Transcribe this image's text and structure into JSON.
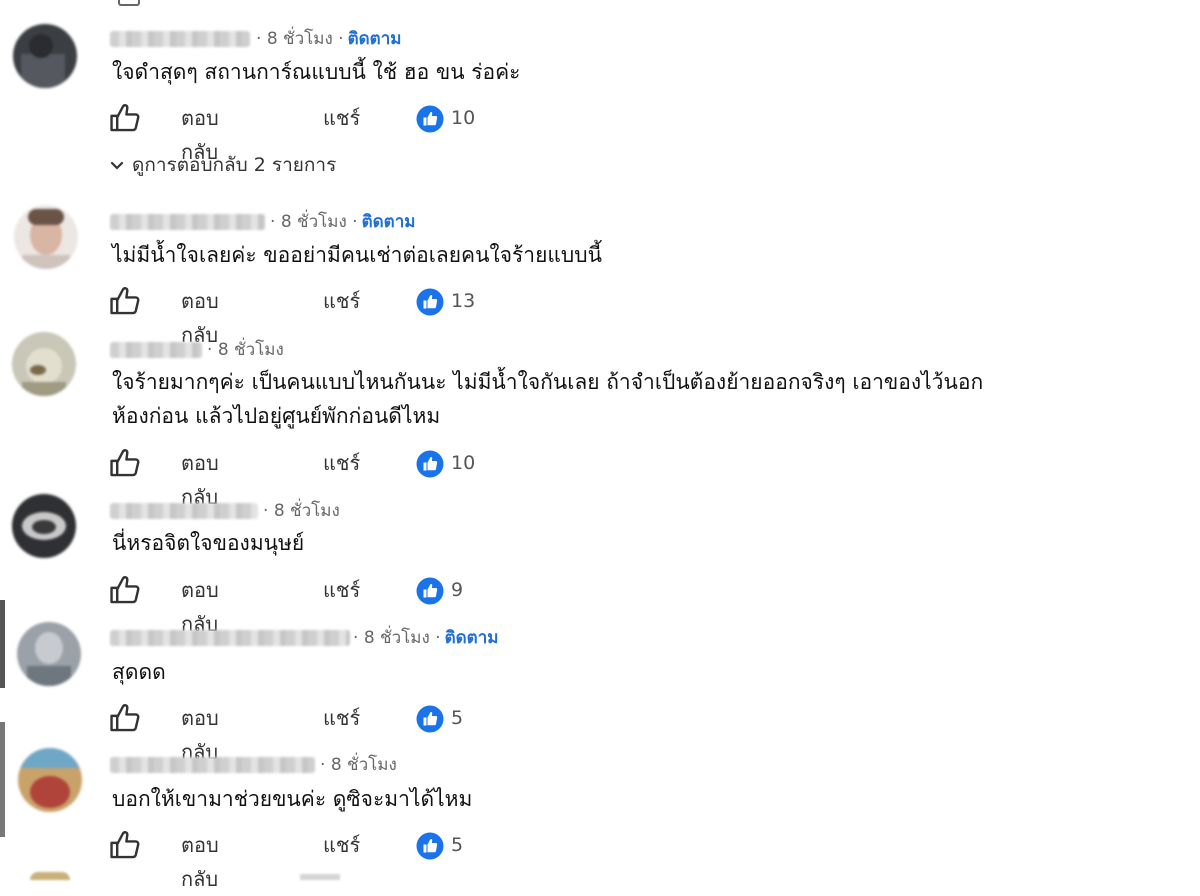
{
  "sep": "·",
  "colors": {
    "link": "#1f6fd6",
    "reaction": "#1a73e8"
  },
  "icons": {
    "like": "thumbs-up-outline-icon",
    "reaction": "thumbs-up-filled-icon",
    "expand": "chevron-down-icon"
  },
  "comments": [
    {
      "time": "8 ชั่วโมง",
      "follow": "ติดตาม",
      "text": [
        "ใจดำสุดๆ สถานการ์ณแบบนี้ ใช้ ฮอ ขน ร่อค่ะ"
      ],
      "reply": "ตอบกลับ",
      "share": "แชร์",
      "likes": "10",
      "replies_toggle": "ดูการตอบกลับ 2 รายการ"
    },
    {
      "time": "8 ชั่วโมง",
      "follow": "ติดตาม",
      "text": [
        "ไม่มีน้ำใจเลยค่ะ ขออย่ามีคนเช่าต่อเลยคนใจร้ายแบบนี้"
      ],
      "reply": "ตอบกลับ",
      "share": "แชร์",
      "likes": "13"
    },
    {
      "time": "8 ชั่วโมง",
      "text": [
        "ใจร้ายมากๆค่ะ เป็นคนแบบไหนกันนะ ไม่มีน้ำใจกันเลย ถ้าจำเป็นต้องย้ายออกจริงๆ เอาของไว้นอก",
        "ห้องก่อน แล้วไปอยู่ศูนย์พักก่อนดีไหม"
      ],
      "reply": "ตอบกลับ",
      "share": "แชร์",
      "likes": "10"
    },
    {
      "time": "8 ชั่วโมง",
      "text": [
        "นี่หรอจิตใจของมนุษย์"
      ],
      "reply": "ตอบกลับ",
      "share": "แชร์",
      "likes": "9"
    },
    {
      "time": "8 ชั่วโมง",
      "follow": "ติดตาม",
      "text": [
        "สุดดด"
      ],
      "reply": "ตอบกลับ",
      "share": "แชร์",
      "likes": "5"
    },
    {
      "time": "8 ชั่วโมง",
      "text": [
        "บอกให้เขามาช่วยขนค่ะ ดูซิจะมาได้ไหม"
      ],
      "reply": "ตอบกลับ",
      "share": "แชร์",
      "likes": "5"
    }
  ]
}
